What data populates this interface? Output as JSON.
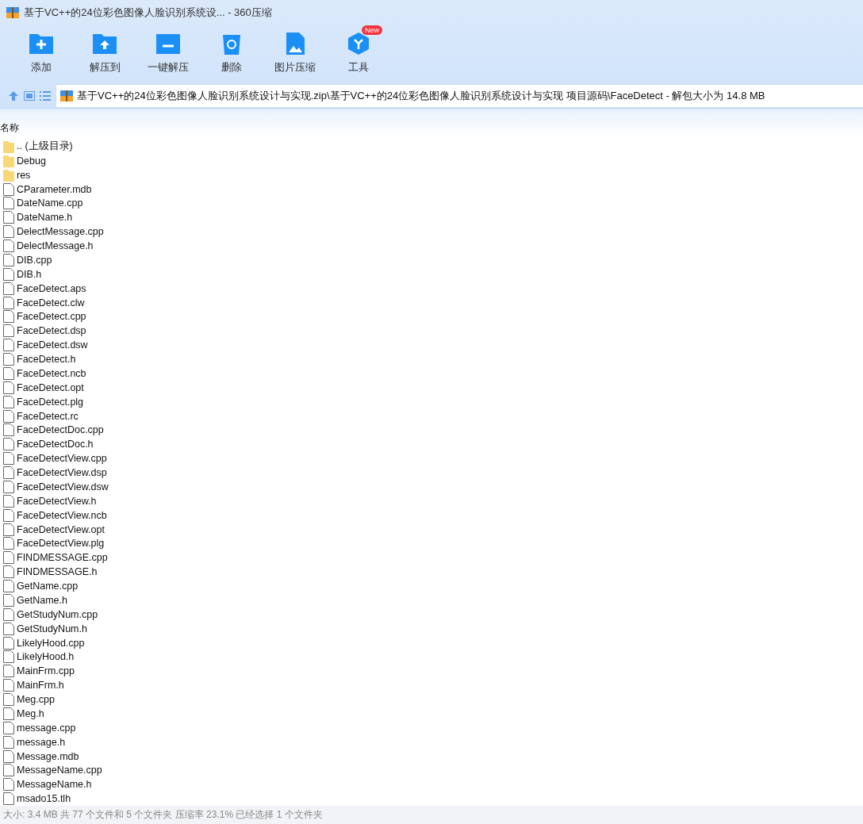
{
  "window": {
    "title": "基于VC++的24位彩色图像人脸识别系统设... - 360压缩"
  },
  "toolbar": [
    {
      "label": "添加",
      "kind": "add"
    },
    {
      "label": "解压到",
      "kind": "extract"
    },
    {
      "label": "一键解压",
      "kind": "oneclick"
    },
    {
      "label": "删除",
      "kind": "delete"
    },
    {
      "label": "图片压缩",
      "kind": "image"
    },
    {
      "label": "工具",
      "kind": "tools",
      "badge": "New"
    }
  ],
  "address": "基于VC++的24位彩色图像人脸识别系统设计与实现.zip\\基于VC++的24位彩色图像人脸识别系统设计与实现 项目源码\\FaceDetect - 解包大小为 14.8 MB",
  "table": {
    "columns": [
      "名称"
    ],
    "rows": [
      {
        "name": ".. (上级目录)",
        "kind": "folder"
      },
      {
        "name": "Debug",
        "kind": "folder"
      },
      {
        "name": "res",
        "kind": "folder"
      },
      {
        "name": "CParameter.mdb",
        "kind": "file"
      },
      {
        "name": "DateName.cpp",
        "kind": "file"
      },
      {
        "name": "DateName.h",
        "kind": "file"
      },
      {
        "name": "DelectMessage.cpp",
        "kind": "file"
      },
      {
        "name": "DelectMessage.h",
        "kind": "file"
      },
      {
        "name": "DIB.cpp",
        "kind": "file"
      },
      {
        "name": "DIB.h",
        "kind": "file"
      },
      {
        "name": "FaceDetect.aps",
        "kind": "file"
      },
      {
        "name": "FaceDetect.clw",
        "kind": "file"
      },
      {
        "name": "FaceDetect.cpp",
        "kind": "file"
      },
      {
        "name": "FaceDetect.dsp",
        "kind": "file"
      },
      {
        "name": "FaceDetect.dsw",
        "kind": "file"
      },
      {
        "name": "FaceDetect.h",
        "kind": "file"
      },
      {
        "name": "FaceDetect.ncb",
        "kind": "file"
      },
      {
        "name": "FaceDetect.opt",
        "kind": "file"
      },
      {
        "name": "FaceDetect.plg",
        "kind": "file"
      },
      {
        "name": "FaceDetect.rc",
        "kind": "file"
      },
      {
        "name": "FaceDetectDoc.cpp",
        "kind": "file"
      },
      {
        "name": "FaceDetectDoc.h",
        "kind": "file"
      },
      {
        "name": "FaceDetectView.cpp",
        "kind": "file"
      },
      {
        "name": "FaceDetectView.dsp",
        "kind": "file"
      },
      {
        "name": "FaceDetectView.dsw",
        "kind": "file"
      },
      {
        "name": "FaceDetectView.h",
        "kind": "file"
      },
      {
        "name": "FaceDetectView.ncb",
        "kind": "file"
      },
      {
        "name": "FaceDetectView.opt",
        "kind": "file"
      },
      {
        "name": "FaceDetectView.plg",
        "kind": "file"
      },
      {
        "name": "FINDMESSAGE.cpp",
        "kind": "file"
      },
      {
        "name": "FINDMESSAGE.h",
        "kind": "file"
      },
      {
        "name": "GetName.cpp",
        "kind": "file"
      },
      {
        "name": "GetName.h",
        "kind": "file"
      },
      {
        "name": "GetStudyNum.cpp",
        "kind": "file"
      },
      {
        "name": "GetStudyNum.h",
        "kind": "file"
      },
      {
        "name": "LikelyHood.cpp",
        "kind": "file"
      },
      {
        "name": "LikelyHood.h",
        "kind": "file"
      },
      {
        "name": "MainFrm.cpp",
        "kind": "file"
      },
      {
        "name": "MainFrm.h",
        "kind": "file"
      },
      {
        "name": "Meg.cpp",
        "kind": "file"
      },
      {
        "name": "Meg.h",
        "kind": "file"
      },
      {
        "name": "message.cpp",
        "kind": "file"
      },
      {
        "name": "message.h",
        "kind": "file"
      },
      {
        "name": "Message.mdb",
        "kind": "file"
      },
      {
        "name": "MessageName.cpp",
        "kind": "file"
      },
      {
        "name": "MessageName.h",
        "kind": "file"
      },
      {
        "name": "msado15.tlh",
        "kind": "file"
      }
    ]
  },
  "status_bar": "大小: 3.4 MB 共 77 个文件和 5 个文件夹 压缩率 23.1% 已经选择 1 个文件夹"
}
